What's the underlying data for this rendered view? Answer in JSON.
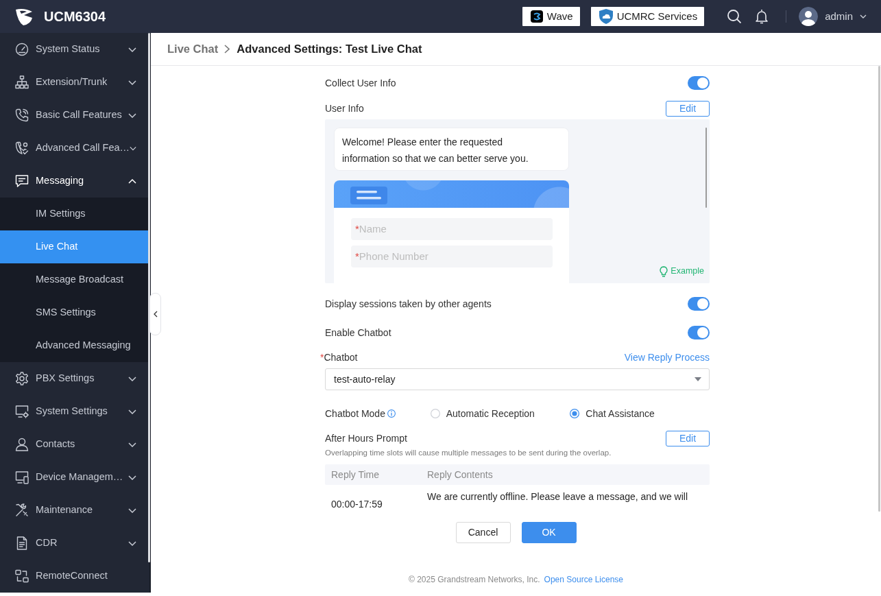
{
  "header": {
    "product": "UCM6304",
    "buttons": [
      "Wave",
      "UCMRC Services"
    ],
    "user": "admin"
  },
  "sidebar": {
    "items": [
      {
        "label": "System Status",
        "expanded": false
      },
      {
        "label": "Extension/Trunk",
        "expanded": false
      },
      {
        "label": "Basic Call Features",
        "expanded": false
      },
      {
        "label": "Advanced Call Fea…",
        "expanded": false
      },
      {
        "label": "Messaging",
        "expanded": true,
        "children": [
          {
            "label": "IM Settings",
            "selected": false
          },
          {
            "label": "Live Chat",
            "selected": true
          },
          {
            "label": "Message Broadcast",
            "selected": false
          },
          {
            "label": "SMS Settings",
            "selected": false
          },
          {
            "label": "Advanced Messaging",
            "selected": false
          }
        ]
      },
      {
        "label": "PBX Settings",
        "expanded": false
      },
      {
        "label": "System Settings",
        "expanded": false
      },
      {
        "label": "Contacts",
        "expanded": false
      },
      {
        "label": "Device Managem…",
        "expanded": false
      },
      {
        "label": "Maintenance",
        "expanded": false
      },
      {
        "label": "CDR",
        "expanded": false
      },
      {
        "label": "RemoteConnect"
      }
    ]
  },
  "breadcrumb": {
    "parent": "Live Chat",
    "current": "Advanced Settings: Test Live Chat"
  },
  "form": {
    "rows": [
      {
        "kind": "toggle",
        "label": "Collect User Info",
        "on": true
      },
      {
        "kind": "preview",
        "label": "User Info",
        "button": "Edit",
        "welcome": "Welcome! Please enter the requested information so that we can better serve you.",
        "fields": [
          {
            "mark": "*",
            "placeholder": "Name"
          },
          {
            "mark": "*",
            "placeholder": "Phone Number"
          }
        ],
        "example": "Example"
      },
      {
        "kind": "toggle",
        "label": "Display sessions taken by other agents",
        "on": true
      },
      {
        "kind": "toggle",
        "label": "Enable Chatbot",
        "on": true
      },
      {
        "kind": "select",
        "mark": "*",
        "label": "Chatbot",
        "link": "View Reply Process",
        "value": "test-auto-relay"
      },
      {
        "kind": "radio",
        "label": "Chatbot Mode",
        "options": [
          {
            "label": "Automatic Reception",
            "selected": false
          },
          {
            "label": "Chat Assistance",
            "selected": true
          }
        ]
      },
      {
        "kind": "table",
        "label": "After Hours Prompt",
        "button": "Edit",
        "hint": "Overlapping time slots will cause multiple messages to be sent during the overlap.",
        "columns": [
          "Reply Time",
          "Reply Contents"
        ],
        "rows": [
          [
            "00:00-17:59",
            "We are currently offline. Please leave a message, and we will"
          ]
        ]
      }
    ]
  },
  "actions": [
    {
      "label": "Cancel",
      "kind": "default"
    },
    {
      "label": "OK",
      "kind": "primary"
    }
  ],
  "footer": {
    "copyright": "© 2025 Grandstream Networks, Inc.",
    "link": "Open Source License"
  }
}
